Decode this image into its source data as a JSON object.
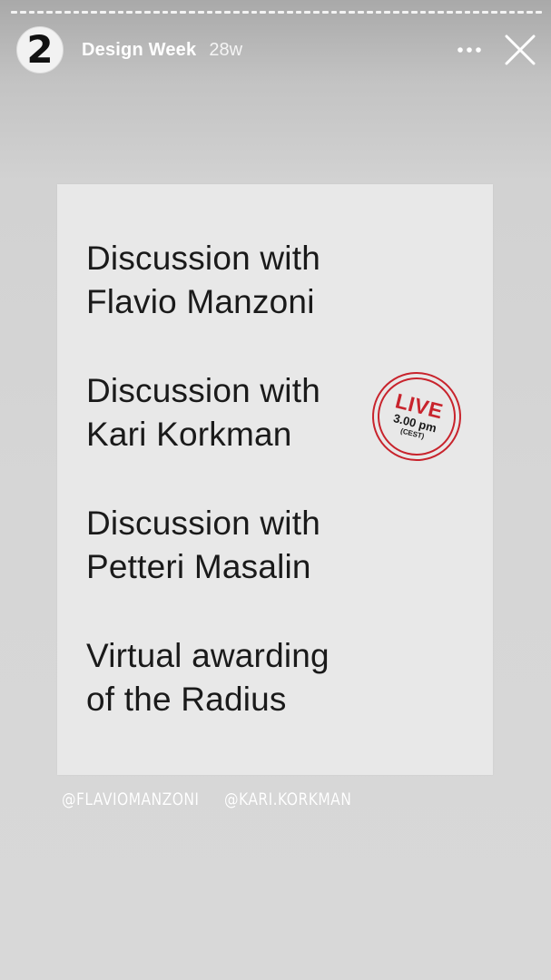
{
  "story": {
    "segment_count": 60,
    "account_name": "Design Week",
    "avatar_text": "2",
    "posted_ago": "28w"
  },
  "icons": {
    "more": "more-horizontal-icon",
    "close": "close-icon"
  },
  "poster": {
    "items": [
      {
        "line1": "Discussion with",
        "line2": "Flavio Manzoni"
      },
      {
        "line1": "Discussion with",
        "line2": "Kari Korkman"
      },
      {
        "line1": "Discussion with",
        "line2": "Petteri Masalin"
      },
      {
        "line1": "Virtual awarding",
        "line2": "of the Radius"
      }
    ],
    "live_badge": {
      "label": "LIVE",
      "time": "3.00 pm",
      "timezone": "(CEST)",
      "color": "#c8232c"
    }
  },
  "mentions": [
    "@FLAVIOMANZONI",
    "@KARI.KORKMAN"
  ]
}
